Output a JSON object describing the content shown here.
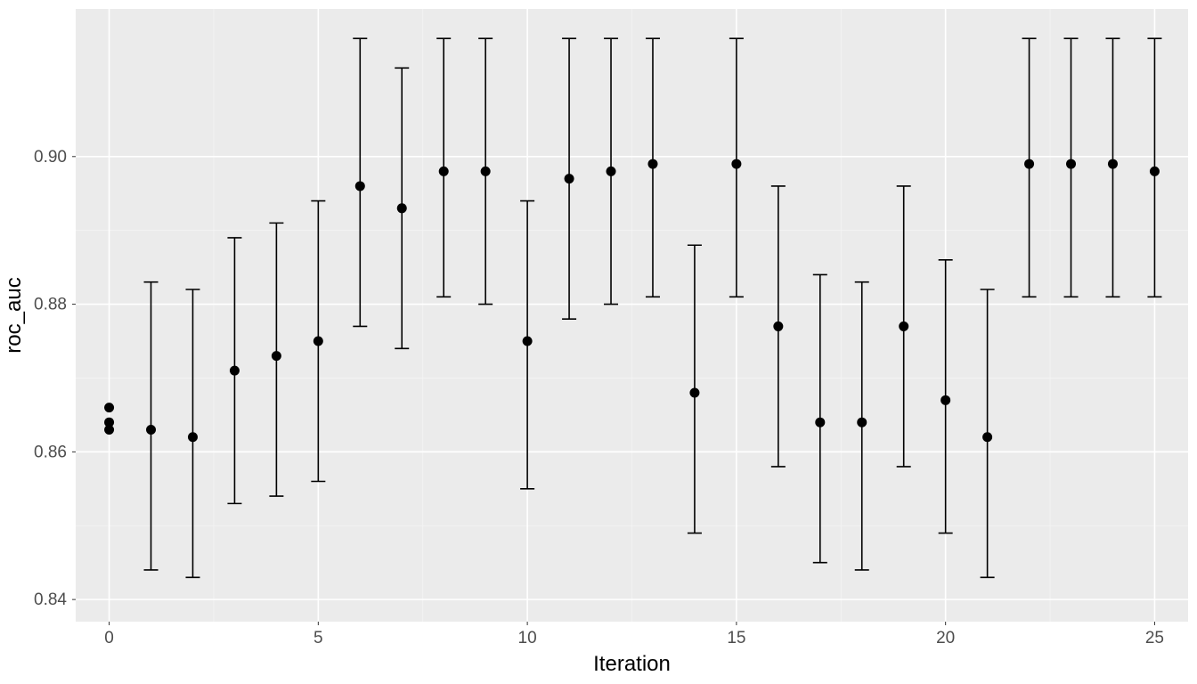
{
  "chart_data": {
    "type": "scatter",
    "xlabel": "Iteration",
    "ylabel": "roc_auc",
    "xlim": [
      -0.8,
      25.8
    ],
    "ylim": [
      0.837,
      0.92
    ],
    "x_ticks": [
      0,
      5,
      10,
      15,
      20,
      25
    ],
    "y_ticks": [
      0.84,
      0.86,
      0.88,
      0.9
    ],
    "initial_points_x0": [
      0.863,
      0.864,
      0.866
    ],
    "series": [
      {
        "x": 1,
        "y": 0.863,
        "lo": 0.844,
        "hi": 0.883
      },
      {
        "x": 2,
        "y": 0.862,
        "lo": 0.843,
        "hi": 0.882
      },
      {
        "x": 3,
        "y": 0.871,
        "lo": 0.853,
        "hi": 0.889
      },
      {
        "x": 4,
        "y": 0.873,
        "lo": 0.854,
        "hi": 0.891
      },
      {
        "x": 5,
        "y": 0.875,
        "lo": 0.856,
        "hi": 0.894
      },
      {
        "x": 6,
        "y": 0.896,
        "lo": 0.877,
        "hi": 0.916
      },
      {
        "x": 7,
        "y": 0.893,
        "lo": 0.874,
        "hi": 0.912
      },
      {
        "x": 8,
        "y": 0.898,
        "lo": 0.881,
        "hi": 0.916
      },
      {
        "x": 9,
        "y": 0.898,
        "lo": 0.88,
        "hi": 0.916
      },
      {
        "x": 10,
        "y": 0.875,
        "lo": 0.855,
        "hi": 0.894
      },
      {
        "x": 11,
        "y": 0.897,
        "lo": 0.878,
        "hi": 0.916
      },
      {
        "x": 12,
        "y": 0.898,
        "lo": 0.88,
        "hi": 0.916
      },
      {
        "x": 13,
        "y": 0.899,
        "lo": 0.881,
        "hi": 0.916
      },
      {
        "x": 14,
        "y": 0.868,
        "lo": 0.849,
        "hi": 0.888
      },
      {
        "x": 15,
        "y": 0.899,
        "lo": 0.881,
        "hi": 0.916
      },
      {
        "x": 16,
        "y": 0.877,
        "lo": 0.858,
        "hi": 0.896
      },
      {
        "x": 17,
        "y": 0.864,
        "lo": 0.845,
        "hi": 0.884
      },
      {
        "x": 18,
        "y": 0.864,
        "lo": 0.844,
        "hi": 0.883
      },
      {
        "x": 19,
        "y": 0.877,
        "lo": 0.858,
        "hi": 0.896
      },
      {
        "x": 20,
        "y": 0.867,
        "lo": 0.849,
        "hi": 0.886
      },
      {
        "x": 21,
        "y": 0.862,
        "lo": 0.843,
        "hi": 0.882
      },
      {
        "x": 22,
        "y": 0.899,
        "lo": 0.881,
        "hi": 0.916
      },
      {
        "x": 23,
        "y": 0.899,
        "lo": 0.881,
        "hi": 0.916
      },
      {
        "x": 24,
        "y": 0.899,
        "lo": 0.881,
        "hi": 0.916
      },
      {
        "x": 25,
        "y": 0.898,
        "lo": 0.881,
        "hi": 0.916
      }
    ]
  }
}
